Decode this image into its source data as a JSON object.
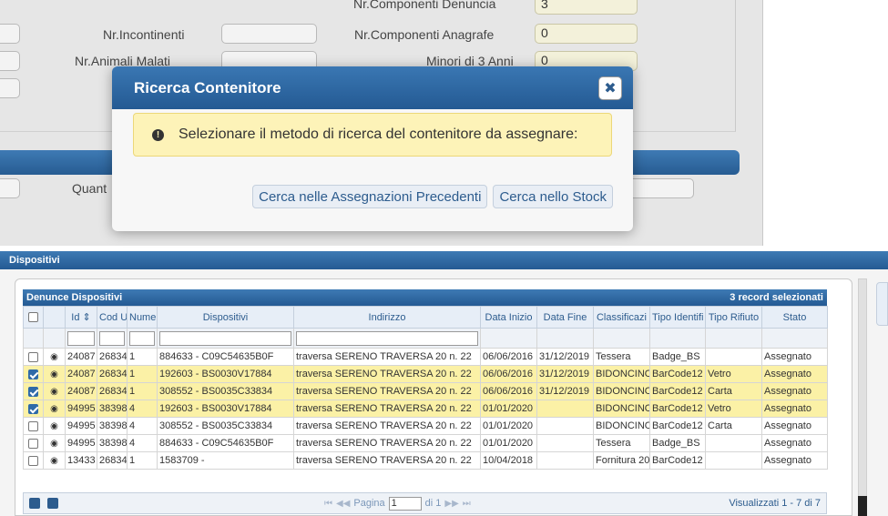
{
  "form": {
    "nr_componenti_denuncia_label": "Nr.Componenti Denuncia",
    "nr_componenti_denuncia_value": "3",
    "nr_incontinenti_label": "Nr.Incontinenti",
    "nr_componenti_anagrafe_label": "Nr.Componenti Anagrafe",
    "nr_componenti_anagrafe_value": "0",
    "nr_animali_malati_label": "Nr.Animali Malati",
    "minori_label": "Minori di 3 Anni",
    "minori_value": "0",
    "quantita_label": "Quant"
  },
  "modal": {
    "title": "Ricerca Contenitore",
    "close_glyph": "✖",
    "alert_text": "Selezionare il metodo di ricerca del contenitore da assegnare:",
    "btn_precedenti": "Cerca nelle Assegnazioni Precedenti",
    "btn_stock": "Cerca nello Stock"
  },
  "section": {
    "title": "Dispositivi"
  },
  "grid": {
    "caption": "Denunce Dispositivi",
    "selected_info": "3 record selezionati",
    "columns": [
      "Id",
      "Cod U",
      "Nume",
      "Dispositivi",
      "Indirizzo",
      "Data Inizio",
      "Data Fine",
      "Classificazi",
      "Tipo Identifi",
      "Tipo Rifiuto",
      "Stato"
    ],
    "rows": [
      {
        "checked": false,
        "id": "24087",
        "cod": "26834",
        "num": "1",
        "disp": "884633 - C09C54635B0F",
        "ind": "traversa SERENO TRAVERSA 20 n. 22",
        "inizio": "06/06/2016",
        "fine": "31/12/2019",
        "classe": "Tessera",
        "tipo_id": "Badge_BS",
        "rifiuto": "",
        "stato": "Assegnato"
      },
      {
        "checked": true,
        "id": "24087",
        "cod": "26834",
        "num": "1",
        "disp": "192603 - BS0030V17884",
        "ind": "traversa SERENO TRAVERSA 20 n. 22",
        "inizio": "06/06/2016",
        "fine": "31/12/2019",
        "classe": "BIDONCINO",
        "tipo_id": "BarCode12",
        "rifiuto": "Vetro",
        "stato": "Assegnato"
      },
      {
        "checked": true,
        "id": "24087",
        "cod": "26834",
        "num": "1",
        "disp": "308552 - BS0035C33834",
        "ind": "traversa SERENO TRAVERSA 20 n. 22",
        "inizio": "06/06/2016",
        "fine": "31/12/2019",
        "classe": "BIDONCINO",
        "tipo_id": "BarCode12",
        "rifiuto": "Carta",
        "stato": "Assegnato"
      },
      {
        "checked": true,
        "id": "94995",
        "cod": "38398",
        "num": "4",
        "disp": "192603 - BS0030V17884",
        "ind": "traversa SERENO TRAVERSA 20 n. 22",
        "inizio": "01/01/2020",
        "fine": "",
        "classe": "BIDONCINO",
        "tipo_id": "BarCode12",
        "rifiuto": "Vetro",
        "stato": "Assegnato"
      },
      {
        "checked": false,
        "id": "94995",
        "cod": "38398",
        "num": "4",
        "disp": "308552 - BS0035C33834",
        "ind": "traversa SERENO TRAVERSA 20 n. 22",
        "inizio": "01/01/2020",
        "fine": "",
        "classe": "BIDONCINO",
        "tipo_id": "BarCode12",
        "rifiuto": "Carta",
        "stato": "Assegnato"
      },
      {
        "checked": false,
        "id": "94995",
        "cod": "38398",
        "num": "4",
        "disp": "884633 - C09C54635B0F",
        "ind": "traversa SERENO TRAVERSA 20 n. 22",
        "inizio": "01/01/2020",
        "fine": "",
        "classe": "Tessera",
        "tipo_id": "Badge_BS",
        "rifiuto": "",
        "stato": "Assegnato"
      },
      {
        "checked": false,
        "id": "13433",
        "cod": "26834",
        "num": "1",
        "disp": "1583709 -",
        "ind": "traversa SERENO TRAVERSA 20 n. 22",
        "inizio": "10/04/2018",
        "fine": "",
        "classe": "Fornitura 20",
        "tipo_id": "BarCode12",
        "rifiuto": "",
        "stato": "Assegnato"
      }
    ],
    "pager": {
      "label_before": "Pagina",
      "page": "1",
      "label_after": "di 1",
      "records_text": "Visualizzati 1 - 7 di 7"
    }
  }
}
